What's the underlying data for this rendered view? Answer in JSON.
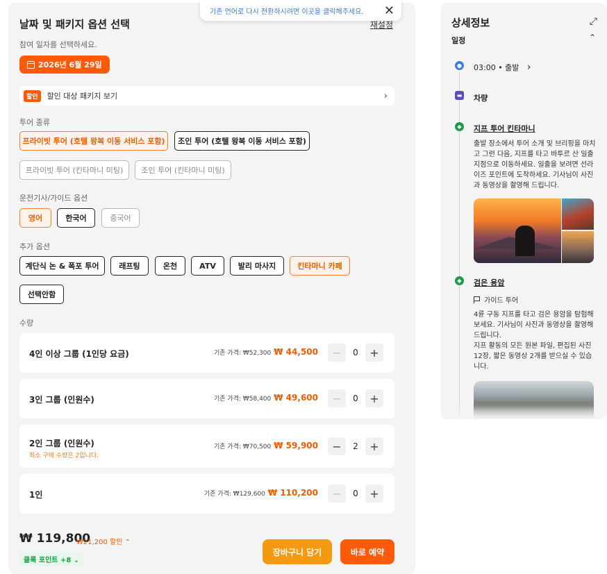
{
  "header": {
    "title": "날짜 및 패키지 옵션 선택",
    "reset": "재설정"
  },
  "date": {
    "hint": "참여 일자를 선택하세요.",
    "selected": "2026년 6월 29일"
  },
  "discount": {
    "badge": "할인",
    "text": "할인 대상 패키지 보기",
    "chevron": "›"
  },
  "tour_type": {
    "label": "투어 종류",
    "options": [
      "프라이빗 투어 (호텔 왕복 이동 서비스 포함)",
      "조인 투어 (호텔 왕복 이동 서비스 포함)",
      "프라이빗 투어 (킨타마니 미팅)",
      "조인 투어 (킨타마니 미팅)"
    ]
  },
  "guide": {
    "label": "운전기사/가이드 옵션",
    "options": [
      "영어",
      "한국어",
      "중국어"
    ]
  },
  "extras": {
    "label": "추가 옵션",
    "options": [
      "계단식 논 & 폭포 투어",
      "래프팅",
      "온천",
      "ATV",
      "발리 마사지",
      "킨타마니 카페",
      "선택안함"
    ]
  },
  "quantity": {
    "label": "수량",
    "rows": [
      {
        "name": "4인 이상 그룹 (1인당 요금)",
        "orig": "기존 가격: ₩52,300",
        "price": "₩ 44,500",
        "count": "0",
        "note": ""
      },
      {
        "name": "3인 그룹 (인원수)",
        "orig": "기존 가격: ₩58,400",
        "price": "₩ 49,600",
        "count": "0",
        "note": ""
      },
      {
        "name": "2인 그룹 (인원수)",
        "orig": "기존 가격: ₩70,500",
        "price": "₩ 59,900",
        "count": "2",
        "note": "최소 구매 수량은 2입니다."
      },
      {
        "name": "1인",
        "orig": "기존 가격: ₩129,600",
        "price": "₩ 110,200",
        "count": "0",
        "note": ""
      }
    ],
    "minus": "−",
    "plus": "+"
  },
  "footer": {
    "total": "₩ 119,800",
    "discount": "₩21,200 할인 ⌃",
    "points": "클룩 포인트 +8 ⌄",
    "cart": "장바구니 담기",
    "book": "바로 예약"
  },
  "toast": {
    "text": "기존 언어로 다시 전환하시려면 이곳을 클릭해주세요.",
    "close": "✕"
  },
  "details": {
    "title": "상세정보",
    "expand": "⤢",
    "section": "일정",
    "collapse": "⌃",
    "items": [
      {
        "text": "03:00 • 출발",
        "chev": "›"
      },
      {
        "text": "차량"
      },
      {
        "text": "지프 투어 킨타마니",
        "desc": "출발 장소에서 투어 소개 및 브리핑을 마치고 그런 다음, 지프를 타고 바투르 산 일출 지점으로 이동하세요. 일출을 보려면 선라이즈 포인트에 도착하세요. 기사님이 사진과 동영상을 촬영해 드립니다."
      },
      {
        "text": "검은 용암",
        "sub": "가이드 투어",
        "desc": "4륜 구동 지프를 타고 검은 용암을 탐험해 보세요. 기사님이 사진과 동영상을 촬영해 드립니다.\n지프 활동의 모든 원본 파일, 편집된 사진 12장, 짧은 동영상 2개를 받으실 수 있습니다."
      }
    ]
  },
  "colors": {
    "accent": "#ff5a0a",
    "cart": "#f59a10",
    "link": "#3b7bd4",
    "points": "#1a9c47"
  }
}
